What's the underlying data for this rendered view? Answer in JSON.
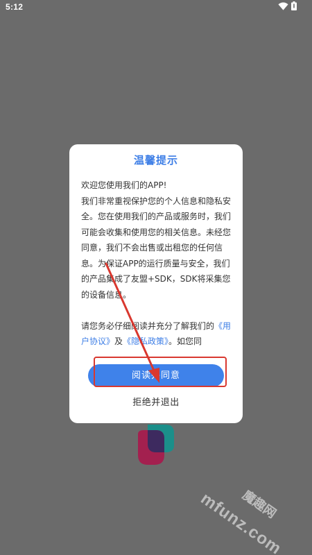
{
  "status_bar": {
    "time": "5:12",
    "icons": [
      "wifi-icon",
      "battery-icon"
    ]
  },
  "dialog": {
    "title": "温馨提示",
    "body_lines": [
      "欢迎您使用我们的APP!",
      "我们非常重视保护您的个人信息和隐私安全。您在使用我们的产品或服务时，我们可能会收集和使用您的相关信息。未经您同意，我们不会出售或出租您的任何信息。为保证APP的运行质量与安全，我们的产品集成了友盟+SDK，SDK将采集您的设备信息。"
    ],
    "notice_prefix": "请您务必仔细阅读并充分了解我们的",
    "user_agreement_link": "《用户协议》",
    "and_text": "及",
    "privacy_policy_link": "《隐私政策》",
    "notice_suffix": "。如您同",
    "agree_button": "阅读并同意",
    "reject_button": "拒绝并退出"
  },
  "watermark": {
    "domain": "mfunz.com",
    "chinese": "魔趣网"
  },
  "colors": {
    "background": "#6b6b6b",
    "accent": "#3d7ee6",
    "annotation": "#d9382f"
  }
}
